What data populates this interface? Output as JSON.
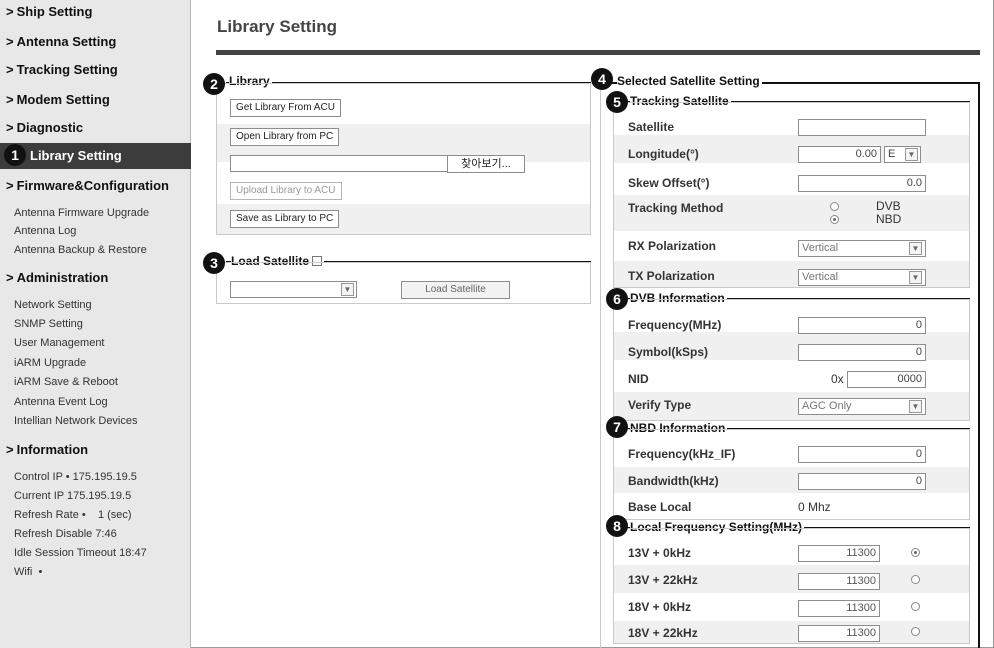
{
  "sidebar": {
    "items": [
      {
        "label": "Ship Setting"
      },
      {
        "label": "Antenna Setting"
      },
      {
        "label": "Tracking Setting"
      },
      {
        "label": "Modem Setting"
      },
      {
        "label": "Diagnostic"
      },
      {
        "label": "Library Setting",
        "active": true
      },
      {
        "label": "Firmware&Configuration"
      },
      {
        "label": "Administration"
      },
      {
        "label": "Information"
      }
    ],
    "firmware_sub": [
      "Antenna Firmware Upgrade",
      "Antenna Log",
      "Antenna Backup & Restore"
    ],
    "admin_sub": [
      "Network Setting",
      "SNMP Setting",
      "User Management",
      "iARM Upgrade",
      "iARM Save & Reboot",
      "Antenna Event Log",
      "Intellian Network Devices"
    ],
    "info_lines": [
      "Control IP • 175.195.19.5",
      "Current IP  175.195.19.5",
      "Refresh Rate •    1 (sec)",
      "Refresh Disable  7:46",
      "Idle Session Timeout  18:47",
      "Wifi  •"
    ]
  },
  "badges": [
    "1",
    "2",
    "3",
    "4",
    "5",
    "6",
    "7",
    "8"
  ],
  "page_title": "Library Setting",
  "library": {
    "title": "Library",
    "get_btn": "Get Library From ACU",
    "open_btn": "Open Library from PC",
    "browse_btn": "찾아보기...",
    "upload_btn": "Upload Library to ACU",
    "save_btn": "Save as Library to PC"
  },
  "load_satellite": {
    "title": "Load Satellite",
    "button": "Load Satellite",
    "select_value": ""
  },
  "selected": {
    "title": "Selected Satellite Setting"
  },
  "tracking": {
    "title": "Tracking Satellite",
    "satellite_label": "Satellite",
    "satellite_value": "",
    "longitude_label": "Longitude(°)",
    "longitude_value": "0.00",
    "longitude_dir": "E",
    "skew_label": "Skew Offset(°)",
    "skew_value": "0.0",
    "method_label": "Tracking Method",
    "method_dvb": "DVB",
    "method_nbd": "NBD",
    "method_selected": "NBD",
    "rx_label": "RX Polarization",
    "rx_value": "Vertical",
    "tx_label": "TX Polarization",
    "tx_value": "Vertical"
  },
  "dvb": {
    "title": "DVB Information",
    "freq_label": "Frequency(MHz)",
    "freq_value": "0",
    "symbol_label": "Symbol(kSps)",
    "symbol_value": "0",
    "nid_label": "NID",
    "nid_prefix": "0x",
    "nid_value": "0000",
    "verify_label": "Verify Type",
    "verify_value": "AGC Only"
  },
  "nbd": {
    "title": "NBD Information",
    "freq_label": "Frequency(kHz_IF)",
    "freq_value": "0",
    "bw_label": "Bandwidth(kHz)",
    "bw_value": "0",
    "base_label": "Base Local",
    "base_value": "0 Mhz"
  },
  "local_freq": {
    "title": "Local Frequency Setting(MHz)",
    "rows": [
      {
        "label": "13V + 0kHz",
        "value": "11300",
        "selected": true
      },
      {
        "label": "13V + 22kHz",
        "value": "11300",
        "selected": false
      },
      {
        "label": "18V + 0kHz",
        "value": "11300",
        "selected": false
      },
      {
        "label": "18V + 22kHz",
        "value": "11300",
        "selected": false
      }
    ]
  }
}
